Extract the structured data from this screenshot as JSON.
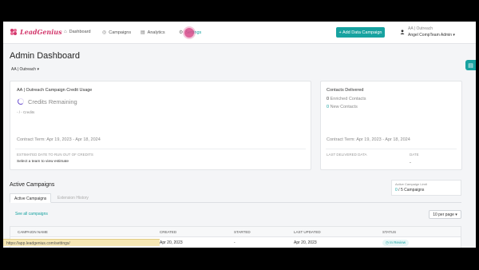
{
  "brand": {
    "name": "LeadGenius",
    "accent": "#17a2a0",
    "logo_color": "#d2386c"
  },
  "nav": {
    "items": [
      {
        "label": "Dashboard",
        "icon": "home-icon"
      },
      {
        "label": "Campaigns",
        "icon": "target-icon"
      },
      {
        "label": "Analytics",
        "icon": "chart-icon"
      },
      {
        "label": "Settings",
        "icon": "gear-icon"
      }
    ],
    "add_button": "+ Add Data Campaign",
    "user": {
      "org": "AA | Outreach",
      "name": "Angel CompTeam Admin"
    }
  },
  "page": {
    "title": "Admin Dashboard",
    "team": "AA | Outreach"
  },
  "credit_card": {
    "title": "AA | Outreach Campaign Credit Usage",
    "credits_remaining_label": "Credits Remaining",
    "credits_line": "- / - Credits",
    "contract_term": "Contract Term: Apr 19, 2023 - Apr 18, 2024",
    "estimate_label": "ESTIMATED DATE TO RUN OUT OF CREDITS",
    "estimate_value": "Select a team to view estimate"
  },
  "contacts_card": {
    "title": "Contacts Delivered",
    "enriched_count": "0",
    "enriched_label": "Enriched Contacts",
    "new_count": "0",
    "new_label": "New Contacts",
    "contract_term": "Contract Term: Apr 19, 2023 - Apr 18, 2024",
    "last_delivered_label": "LAST DELIVERED DATA",
    "date_label": "DATE",
    "date_value": "-"
  },
  "campaigns": {
    "title": "Active Campaigns",
    "limit_label": "Active Campaign Limit",
    "limit_count": "0",
    "limit_value": "/ 5 Campaigns",
    "tabs": [
      "Active Campaigns",
      "Extension History"
    ],
    "see_all": "See all campaigns",
    "per_page": "10 per page",
    "columns": [
      "CAMPAIGN NAME",
      "CREATED",
      "STARTED",
      "LAST UPDATED",
      "STATUS"
    ],
    "rows": [
      {
        "name": "",
        "created": "Apr 20, 2023",
        "started": "-",
        "updated": "Apr 20, 2023",
        "status": "In Review"
      }
    ]
  },
  "status_url": "https://app.leadgenius.com/settings/"
}
